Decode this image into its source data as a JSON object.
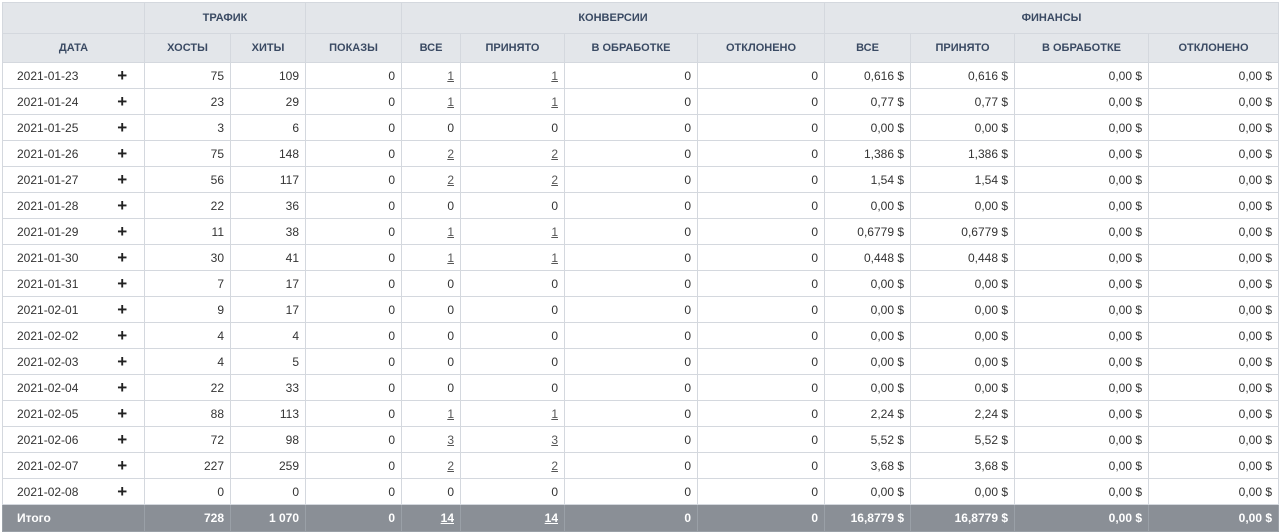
{
  "groups": {
    "traffic": "ТРАФИК",
    "conversions": "КОНВЕРСИИ",
    "finance": "ФИНАНСЫ"
  },
  "cols": {
    "date": "ДАТА",
    "hosts": "ХОСТЫ",
    "hits": "ХИТЫ",
    "shows": "ПОКАЗЫ",
    "conv_all": "ВСЕ",
    "conv_accepted": "ПРИНЯТО",
    "conv_processing": "В ОБРАБОТКЕ",
    "conv_rejected": "ОТКЛОНЕНО",
    "fin_all": "ВСЕ",
    "fin_accepted": "ПРИНЯТО",
    "fin_processing": "В ОБРАБОТКЕ",
    "fin_rejected": "ОТКЛОНЕНО"
  },
  "expand_glyph": "+",
  "rows": [
    {
      "date": "2021-01-23",
      "hosts": "75",
      "hits": "109",
      "shows": "0",
      "conv_all": "1",
      "conv_accepted": "1",
      "conv_processing": "0",
      "conv_rejected": "0",
      "fin_all": "0,616 $",
      "fin_accepted": "0,616 $",
      "fin_processing": "0,00 $",
      "fin_rejected": "0,00 $"
    },
    {
      "date": "2021-01-24",
      "hosts": "23",
      "hits": "29",
      "shows": "0",
      "conv_all": "1",
      "conv_accepted": "1",
      "conv_processing": "0",
      "conv_rejected": "0",
      "fin_all": "0,77 $",
      "fin_accepted": "0,77 $",
      "fin_processing": "0,00 $",
      "fin_rejected": "0,00 $"
    },
    {
      "date": "2021-01-25",
      "hosts": "3",
      "hits": "6",
      "shows": "0",
      "conv_all": "0",
      "conv_accepted": "0",
      "conv_processing": "0",
      "conv_rejected": "0",
      "fin_all": "0,00 $",
      "fin_accepted": "0,00 $",
      "fin_processing": "0,00 $",
      "fin_rejected": "0,00 $"
    },
    {
      "date": "2021-01-26",
      "hosts": "75",
      "hits": "148",
      "shows": "0",
      "conv_all": "2",
      "conv_accepted": "2",
      "conv_processing": "0",
      "conv_rejected": "0",
      "fin_all": "1,386 $",
      "fin_accepted": "1,386 $",
      "fin_processing": "0,00 $",
      "fin_rejected": "0,00 $"
    },
    {
      "date": "2021-01-27",
      "hosts": "56",
      "hits": "117",
      "shows": "0",
      "conv_all": "2",
      "conv_accepted": "2",
      "conv_processing": "0",
      "conv_rejected": "0",
      "fin_all": "1,54 $",
      "fin_accepted": "1,54 $",
      "fin_processing": "0,00 $",
      "fin_rejected": "0,00 $"
    },
    {
      "date": "2021-01-28",
      "hosts": "22",
      "hits": "36",
      "shows": "0",
      "conv_all": "0",
      "conv_accepted": "0",
      "conv_processing": "0",
      "conv_rejected": "0",
      "fin_all": "0,00 $",
      "fin_accepted": "0,00 $",
      "fin_processing": "0,00 $",
      "fin_rejected": "0,00 $"
    },
    {
      "date": "2021-01-29",
      "hosts": "11",
      "hits": "38",
      "shows": "0",
      "conv_all": "1",
      "conv_accepted": "1",
      "conv_processing": "0",
      "conv_rejected": "0",
      "fin_all": "0,6779 $",
      "fin_accepted": "0,6779 $",
      "fin_processing": "0,00 $",
      "fin_rejected": "0,00 $"
    },
    {
      "date": "2021-01-30",
      "hosts": "30",
      "hits": "41",
      "shows": "0",
      "conv_all": "1",
      "conv_accepted": "1",
      "conv_processing": "0",
      "conv_rejected": "0",
      "fin_all": "0,448 $",
      "fin_accepted": "0,448 $",
      "fin_processing": "0,00 $",
      "fin_rejected": "0,00 $"
    },
    {
      "date": "2021-01-31",
      "hosts": "7",
      "hits": "17",
      "shows": "0",
      "conv_all": "0",
      "conv_accepted": "0",
      "conv_processing": "0",
      "conv_rejected": "0",
      "fin_all": "0,00 $",
      "fin_accepted": "0,00 $",
      "fin_processing": "0,00 $",
      "fin_rejected": "0,00 $"
    },
    {
      "date": "2021-02-01",
      "hosts": "9",
      "hits": "17",
      "shows": "0",
      "conv_all": "0",
      "conv_accepted": "0",
      "conv_processing": "0",
      "conv_rejected": "0",
      "fin_all": "0,00 $",
      "fin_accepted": "0,00 $",
      "fin_processing": "0,00 $",
      "fin_rejected": "0,00 $"
    },
    {
      "date": "2021-02-02",
      "hosts": "4",
      "hits": "4",
      "shows": "0",
      "conv_all": "0",
      "conv_accepted": "0",
      "conv_processing": "0",
      "conv_rejected": "0",
      "fin_all": "0,00 $",
      "fin_accepted": "0,00 $",
      "fin_processing": "0,00 $",
      "fin_rejected": "0,00 $"
    },
    {
      "date": "2021-02-03",
      "hosts": "4",
      "hits": "5",
      "shows": "0",
      "conv_all": "0",
      "conv_accepted": "0",
      "conv_processing": "0",
      "conv_rejected": "0",
      "fin_all": "0,00 $",
      "fin_accepted": "0,00 $",
      "fin_processing": "0,00 $",
      "fin_rejected": "0,00 $"
    },
    {
      "date": "2021-02-04",
      "hosts": "22",
      "hits": "33",
      "shows": "0",
      "conv_all": "0",
      "conv_accepted": "0",
      "conv_processing": "0",
      "conv_rejected": "0",
      "fin_all": "0,00 $",
      "fin_accepted": "0,00 $",
      "fin_processing": "0,00 $",
      "fin_rejected": "0,00 $"
    },
    {
      "date": "2021-02-05",
      "hosts": "88",
      "hits": "113",
      "shows": "0",
      "conv_all": "1",
      "conv_accepted": "1",
      "conv_processing": "0",
      "conv_rejected": "0",
      "fin_all": "2,24 $",
      "fin_accepted": "2,24 $",
      "fin_processing": "0,00 $",
      "fin_rejected": "0,00 $"
    },
    {
      "date": "2021-02-06",
      "hosts": "72",
      "hits": "98",
      "shows": "0",
      "conv_all": "3",
      "conv_accepted": "3",
      "conv_processing": "0",
      "conv_rejected": "0",
      "fin_all": "5,52 $",
      "fin_accepted": "5,52 $",
      "fin_processing": "0,00 $",
      "fin_rejected": "0,00 $"
    },
    {
      "date": "2021-02-07",
      "hosts": "227",
      "hits": "259",
      "shows": "0",
      "conv_all": "2",
      "conv_accepted": "2",
      "conv_processing": "0",
      "conv_rejected": "0",
      "fin_all": "3,68 $",
      "fin_accepted": "3,68 $",
      "fin_processing": "0,00 $",
      "fin_rejected": "0,00 $"
    },
    {
      "date": "2021-02-08",
      "hosts": "0",
      "hits": "0",
      "shows": "0",
      "conv_all": "0",
      "conv_accepted": "0",
      "conv_processing": "0",
      "conv_rejected": "0",
      "fin_all": "0,00 $",
      "fin_accepted": "0,00 $",
      "fin_processing": "0,00 $",
      "fin_rejected": "0,00 $"
    }
  ],
  "totals": {
    "label": "Итого",
    "hosts": "728",
    "hits": "1 070",
    "shows": "0",
    "conv_all": "14",
    "conv_accepted": "14",
    "conv_processing": "0",
    "conv_rejected": "0",
    "fin_all": "16,8779 $",
    "fin_accepted": "16,8779 $",
    "fin_processing": "0,00 $",
    "fin_rejected": "0,00 $"
  }
}
